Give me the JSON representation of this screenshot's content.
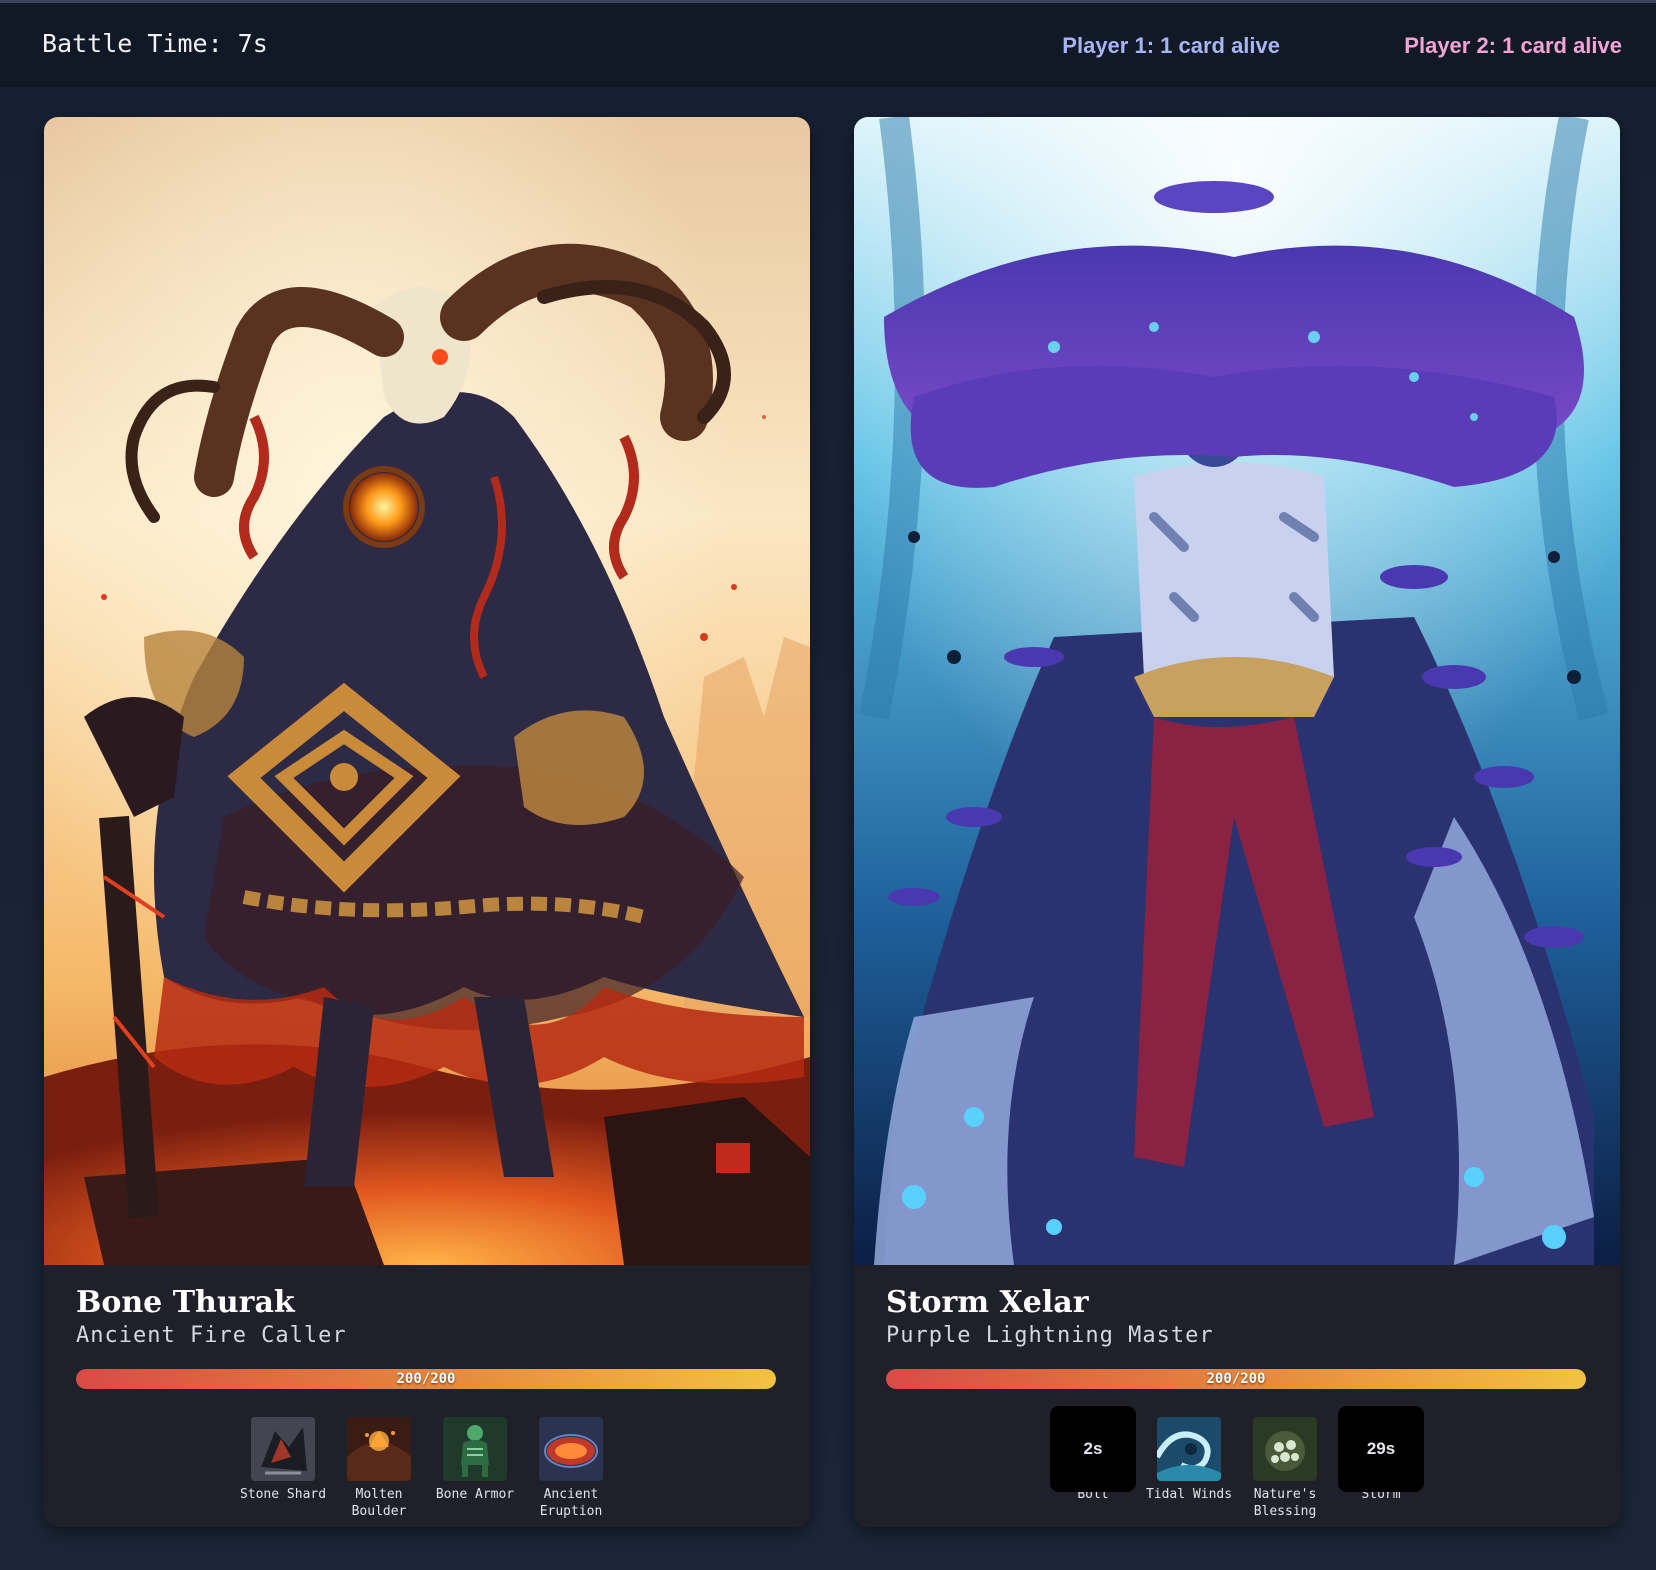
{
  "header": {
    "battle_time": "Battle Time: 7s",
    "player1_status": "Player 1: 1 card alive",
    "player2_status": "Player 2: 1 card alive",
    "player1_color": "#a9b4f5",
    "player2_color": "#f5a3d4"
  },
  "cards": [
    {
      "name": "Bone Thurak",
      "title": "Ancient Fire Caller",
      "hp": {
        "current": 200,
        "max": 200,
        "label": "200/200",
        "fraction": 1.0
      },
      "art_icon": "horned-fire-demon-art",
      "abilities": [
        {
          "label": "Stone Shard",
          "icon": "stone-shard-icon",
          "cooldown": ""
        },
        {
          "label": "Molten Boulder",
          "icon": "molten-boulder-icon",
          "cooldown": ""
        },
        {
          "label": "Bone Armor",
          "icon": "bone-armor-icon",
          "cooldown": ""
        },
        {
          "label": "Ancient Eruption",
          "icon": "ancient-eruption-icon",
          "cooldown": ""
        }
      ]
    },
    {
      "name": "Storm Xelar",
      "title": "Purple Lightning Master",
      "hp": {
        "current": 200,
        "max": 200,
        "label": "200/200",
        "fraction": 1.0
      },
      "art_icon": "mushroom-lightning-mage-art",
      "abilities": [
        {
          "label": "Bolt",
          "icon": "bolt-icon",
          "cooldown": "2s"
        },
        {
          "label": "Tidal Winds",
          "icon": "tidal-winds-icon",
          "cooldown": ""
        },
        {
          "label": "Nature's Blessing",
          "icon": "natures-blessing-icon",
          "cooldown": ""
        },
        {
          "label": "Storm",
          "icon": "storm-icon",
          "cooldown": "29s"
        }
      ]
    }
  ]
}
